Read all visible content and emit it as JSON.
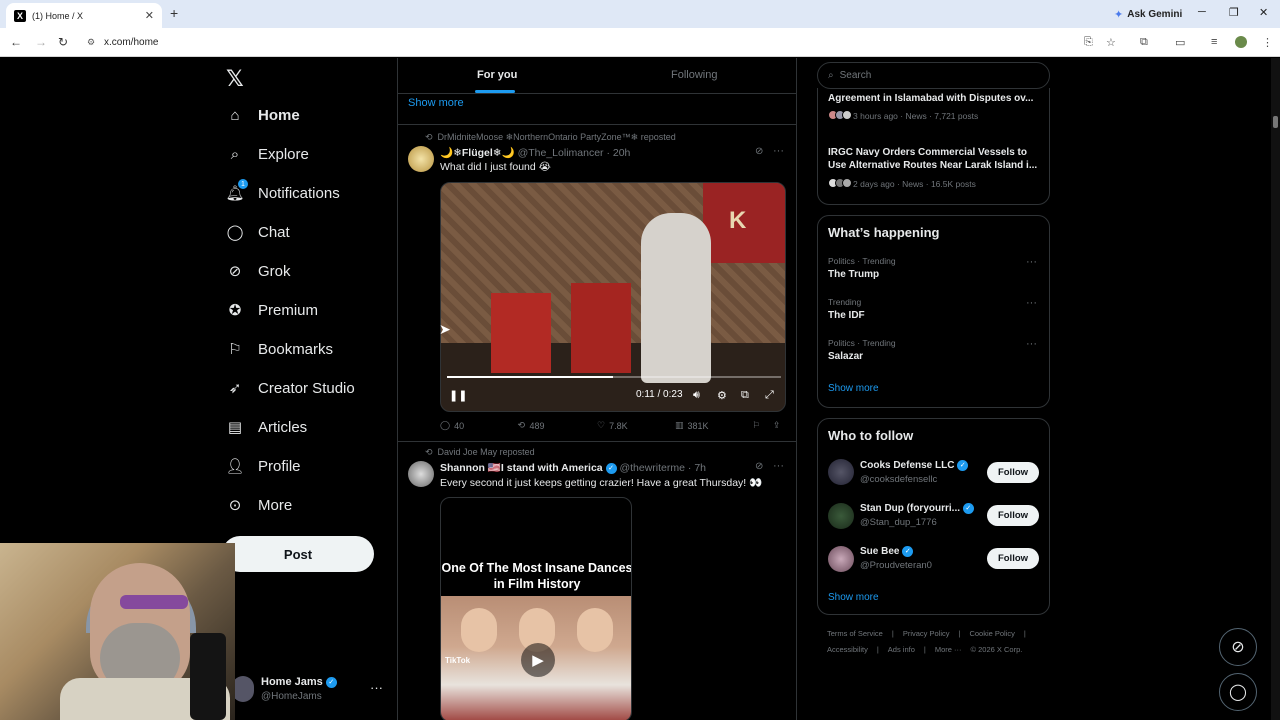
{
  "browser": {
    "tab_title": "(1) Home / X",
    "tab_close": "✕",
    "new_tab": "+",
    "url": "x.com/home",
    "ask_gemini": "Ask Gemini"
  },
  "nav": {
    "items": [
      {
        "label": "Home",
        "icon": "home-icon"
      },
      {
        "label": "Explore",
        "icon": "search-icon"
      },
      {
        "label": "Notifications",
        "icon": "bell-icon",
        "badge": "1"
      },
      {
        "label": "Chat",
        "icon": "chat-icon"
      },
      {
        "label": "Grok",
        "icon": "grok-icon"
      },
      {
        "label": "Premium",
        "icon": "premium-icon"
      },
      {
        "label": "Bookmarks",
        "icon": "bookmark-icon"
      },
      {
        "label": "Creator Studio",
        "icon": "rocket-icon"
      },
      {
        "label": "Articles",
        "icon": "articles-icon"
      },
      {
        "label": "Profile",
        "icon": "person-icon"
      },
      {
        "label": "More",
        "icon": "more-icon"
      }
    ],
    "post_label": "Post",
    "account_name": "Home Jams",
    "account_handle": "@HomeJams"
  },
  "timeline": {
    "tab_for_you": "For you",
    "tab_following": "Following",
    "show_more": "Show more",
    "post1": {
      "repost_by": "DrMidniteMoose ❄NorthernOntario PartyZone™❄ reposted",
      "name": "🌙❄Flügel❄🌙",
      "handle": "@The_Lolimancer",
      "time": "· 20h",
      "text": "What did I just found 😭",
      "video_time": "0:11 / 0:23",
      "video_banner": "K",
      "replies": "40",
      "reposts": "489",
      "likes": "7.8K",
      "views": "381K"
    },
    "post2": {
      "repost_by": "David Joe May reposted",
      "name": "Shannon 🇺🇸I stand with America",
      "handle": "@thewriterme",
      "time": "· 7h",
      "text": "Every second it just keeps getting crazier! Have a great Thursday! 👀",
      "video_title": "One Of The Most Insane Dances in Film History",
      "tiktok": "TikTok"
    }
  },
  "sidebar": {
    "search_placeholder": "Search",
    "news": [
      {
        "title": "Agreement in Islamabad with Disputes ov...",
        "meta": "3 hours ago · News · 7,721 posts"
      },
      {
        "title": "IRGC Navy Orders Commercial Vessels to Use Alternative Routes Near Larak Island i...",
        "meta": "2 days ago · News · 16.5K posts"
      }
    ],
    "happening_title": "What’s happening",
    "trends": [
      {
        "meta": "Politics · Trending",
        "name": "The Trump"
      },
      {
        "meta": "Trending",
        "name": "The IDF"
      },
      {
        "meta": "Politics · Trending",
        "name": "Salazar"
      }
    ],
    "show_more": "Show more",
    "wtf_title": "Who to follow",
    "follow_label": "Follow",
    "who_to_follow": [
      {
        "name": "Cooks Defense LLC",
        "handle": "@cooksdefensellc"
      },
      {
        "name": "Stan Dup (foryourri...",
        "handle": "@Stan_dup_1776"
      },
      {
        "name": "Sue Bee",
        "handle": "@Proudveteran0"
      }
    ],
    "wtf_show_more": "Show more",
    "footer": [
      "Terms of Service",
      "|",
      "Privacy Policy",
      "|",
      "Cookie Policy",
      "|",
      "Accessibility",
      "|",
      "Ads info",
      "|",
      "More ···",
      "© 2026 X Corp."
    ]
  },
  "colors": {
    "accent": "#1d9bf0",
    "background": "#000000",
    "text": "#e7e9ea",
    "muted": "#71767b",
    "border": "#2f3336"
  }
}
